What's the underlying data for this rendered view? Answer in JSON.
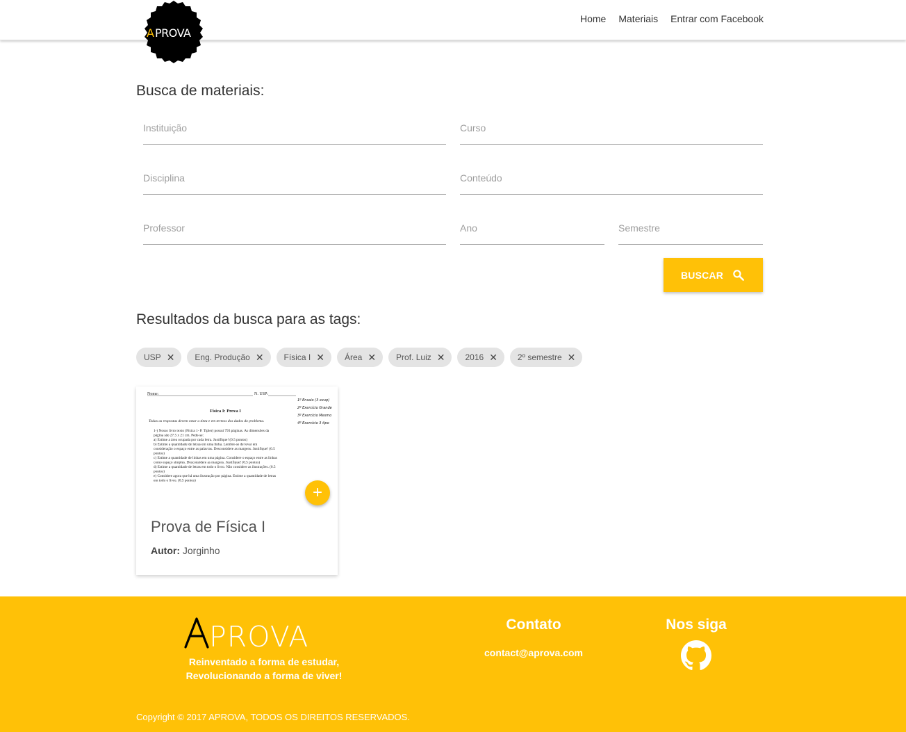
{
  "navbar": {
    "logo_text": "APROVA",
    "links": [
      "Home",
      "Materiais",
      "Entrar com Facebook"
    ]
  },
  "search": {
    "title": "Busca de materiais:",
    "fields": {
      "instituicao": "Instituição",
      "curso": "Curso",
      "disciplina": "Disciplina",
      "conteudo": "Conteúdo",
      "professor": "Professor",
      "ano": "Ano",
      "semestre": "Semestre"
    },
    "button_label": "BUSCAR"
  },
  "results": {
    "title": "Resultados da busca para as tags:",
    "tags": [
      "USP",
      "Eng. Produção",
      "Física I",
      "Área",
      "Prof. Luiz",
      "2016",
      "2º semestre"
    ]
  },
  "card": {
    "title": "Prova de Física I",
    "author_label": "Autor:",
    "author": "Jorginho",
    "thumb": {
      "name_label": "Nome:",
      "nusp_label": "N. USP:",
      "heading": "Física I: Prova I",
      "bullet": "Todas as respostas devem estar a tinta e em termos dos dados do problema.",
      "lines": [
        "1-) Nosso livro texto (Física 1- P. Tipler) possui 793 páginas. As dimensões da",
        "página são 27.5 x 21 cm. Pede-se:",
        "a) Estime a área ocupada por cada letra. Justifique! (0.5 pontos)",
        "b) Estime a quantidade de letras em uma linha. Lembre-se de levar em",
        "consideração o espaço entre as palavras. Desconsidere as margens. Justifique! (0.5",
        "pontos)",
        "c) Estime a quantidade de linhas em uma página. Considere o espaço entre as linhas",
        "como espaço simples. Desconsidere as margens. Justifique! (0.5 pontos)",
        "d) Estime a quantidade de letras em todo o livro. Não considere as ilustrações. (0.5",
        "pontos)",
        "e) Considere agora que há uma ilustração por página. Estime a quantidade de letras",
        "em todo o livro. (0.5 pontos)"
      ],
      "handwritten": [
        "1º Ensaio (3 exup)",
        "2º Exercício Grande",
        "3º Exercício Mesmo",
        "4º Exercício 3 tipo"
      ]
    },
    "add_symbol": "+"
  },
  "footer": {
    "logo_text": "APROVA",
    "tagline_1": "Reinventado a forma de estudar,",
    "tagline_2": "Revolucionando a forma de viver!",
    "contato_title": "Contato",
    "contato_email": "contact@aprova.com",
    "siga_title": "Nos siga",
    "copyright": "Copyright © 2017 APROVA, TODOS OS DIREITOS RESERVADOS."
  },
  "colors": {
    "accent": "#ffc107",
    "chip_bg": "#e4e4e4",
    "logo_bg": "#000000",
    "logo_a": "#ffc107"
  },
  "icons": {
    "search": "search-icon",
    "close": "close-icon",
    "add": "add-icon",
    "github": "github-icon"
  }
}
